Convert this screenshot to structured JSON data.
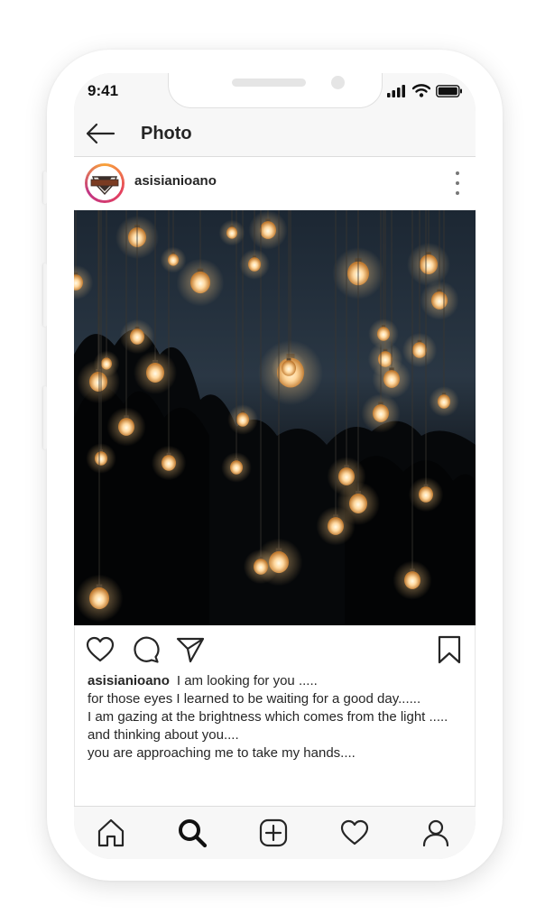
{
  "status_bar": {
    "time": "9:41",
    "icons": [
      "signal-icon",
      "wifi-icon",
      "battery-icon"
    ]
  },
  "nav": {
    "title": "Photo",
    "back_icon": "back-arrow-icon"
  },
  "post": {
    "username": "asisianioano",
    "avatar_icon": "harley-davidson-logo",
    "more_icon": "more-vertical-icon",
    "photo_alt": "photo",
    "actions": [
      "heart-icon",
      "comment-icon",
      "share-icon",
      "bookmark-icon"
    ],
    "caption": {
      "username": "asisianioano",
      "first_line": "I am looking for you .....",
      "lines": [
        "for those eyes I learned to be waiting for a good day......",
        "I am gazing at the brightness which comes from the light .....",
        "and thinking about you....",
        "you are approaching me to take my hands...."
      ]
    }
  },
  "tab_bar": {
    "items": [
      "home-icon",
      "search-icon",
      "add-post-icon",
      "activity-heart-icon",
      "profile-icon"
    ],
    "active": "search-icon"
  },
  "colors": {
    "ui_background": "#f7f7f7",
    "text": "#262626",
    "divider": "#dcdcdc",
    "story_ring": [
      "#f9a43a",
      "#e4405f",
      "#c13584"
    ]
  }
}
